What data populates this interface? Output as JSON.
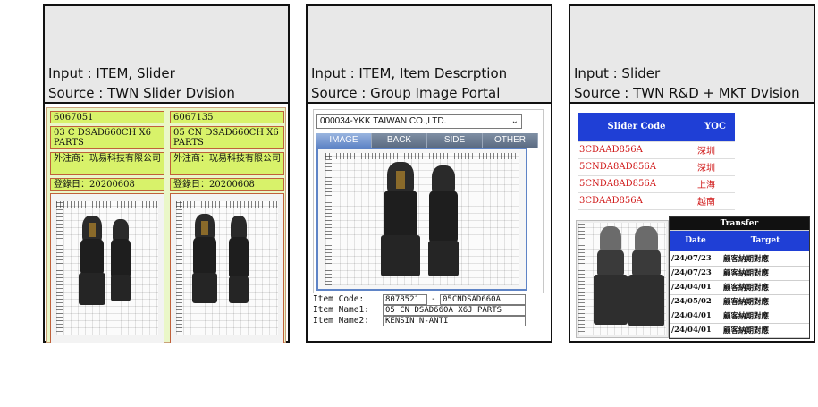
{
  "panels": [
    {
      "input": "Input : ITEM, Slider",
      "source": "Source : TWN Slider Dvision"
    },
    {
      "input": "Input : ITEM, Item Descrption",
      "source": "Source : Group Image Portal"
    },
    {
      "input": "Input : Slider",
      "source": "Source : TWN R&D + MKT Dvision"
    }
  ],
  "slider_cards": [
    {
      "id": "6067051",
      "desc": "03 C DSAD660CH X6 PARTS",
      "vendor": "外注商：珖易科技有限公司",
      "date": "登錄日：20200608"
    },
    {
      "id": "6067135",
      "desc": "05 CN DSAD660CH X6 PARTS",
      "vendor": "外注商：珖易科技有限公司",
      "date": "登錄日：20200608"
    }
  ],
  "portal": {
    "company_select": "000034-YKK TAIWAN CO.,LTD.",
    "tabs": [
      "IMAGE",
      "BACK",
      "SIDE",
      "OTHER"
    ],
    "active_tab": "IMAGE",
    "item_code_label": "Item Code:",
    "item_code": "8078521",
    "item_code_sep": "-",
    "item_code2": "05CNDSAD660A",
    "item_name1_label": "Item Name1:",
    "item_name1": "05 CN DSAD660A X6J PARTS",
    "item_name2_label": "Item Name2:",
    "item_name2": "KENSIN N-ANTI"
  },
  "yoc_table": {
    "col1": "Slider Code",
    "col2": "YOC",
    "rows": [
      {
        "code": "3CDAAD856A",
        "yoc": "深圳"
      },
      {
        "code": "5CNDA8AD856A",
        "yoc": "深圳"
      },
      {
        "code": "5CNDA8AD856A",
        "yoc": "上海"
      },
      {
        "code": "3CDAAD856A",
        "yoc": "越南"
      }
    ]
  },
  "transfer_table": {
    "caption": "Transfer",
    "col1": "Date",
    "col2": "Target",
    "rows": [
      {
        "date": "/24/07/23",
        "target": "顧客納期對應"
      },
      {
        "date": "/24/07/23",
        "target": "顧客納期對應"
      },
      {
        "date": "/24/04/01",
        "target": "顧客納期對應"
      },
      {
        "date": "/24/05/02",
        "target": "顧客納期對應"
      },
      {
        "date": "/24/04/01",
        "target": "顧客納期對應"
      },
      {
        "date": "/24/04/01",
        "target": "顧客納期對應"
      }
    ]
  }
}
